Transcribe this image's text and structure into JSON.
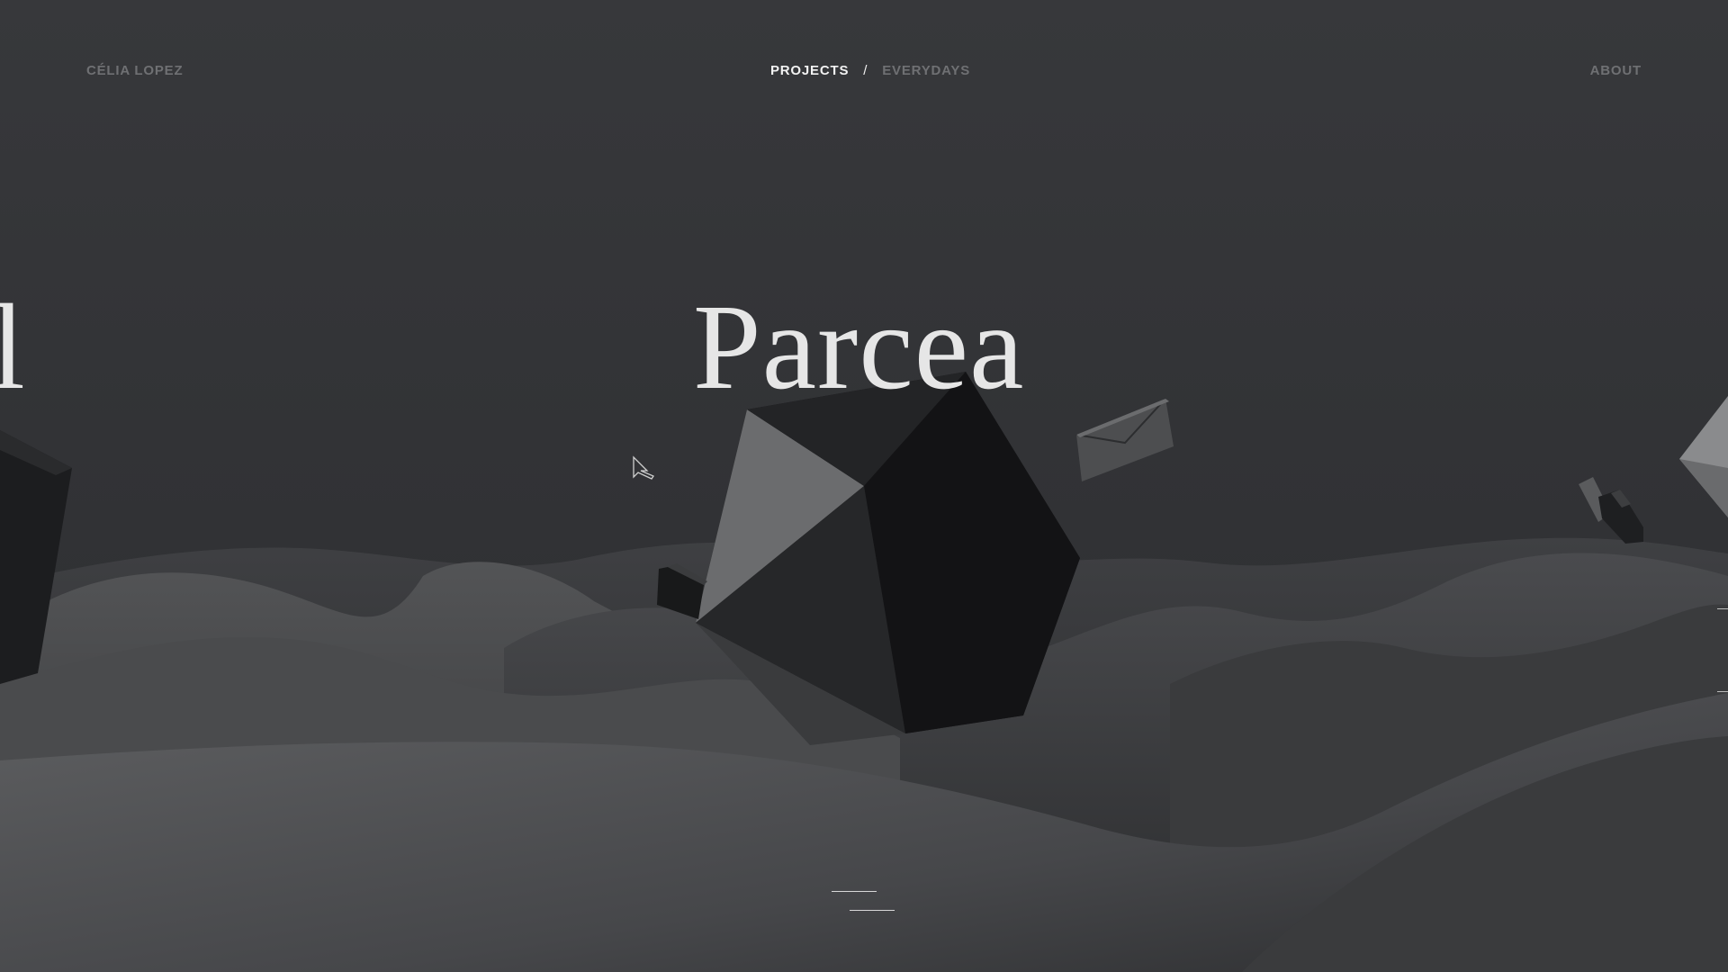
{
  "header": {
    "brand": "CÉLIA LOPEZ",
    "nav": {
      "projects": "PROJECTS",
      "separator": "/",
      "everydays": "EVERYDAYS"
    },
    "about": "ABOUT"
  },
  "slider": {
    "current_title": "Parcea",
    "previous_title_fragment": "l"
  },
  "colors": {
    "background": "#353638",
    "nav_active": "#f2f2f2",
    "nav_inactive": "#6f7073",
    "title": "#e6e6e6"
  },
  "icons": {
    "cursor": "arrow-cursor-icon",
    "scroll": "scroll-indicator-icon"
  }
}
